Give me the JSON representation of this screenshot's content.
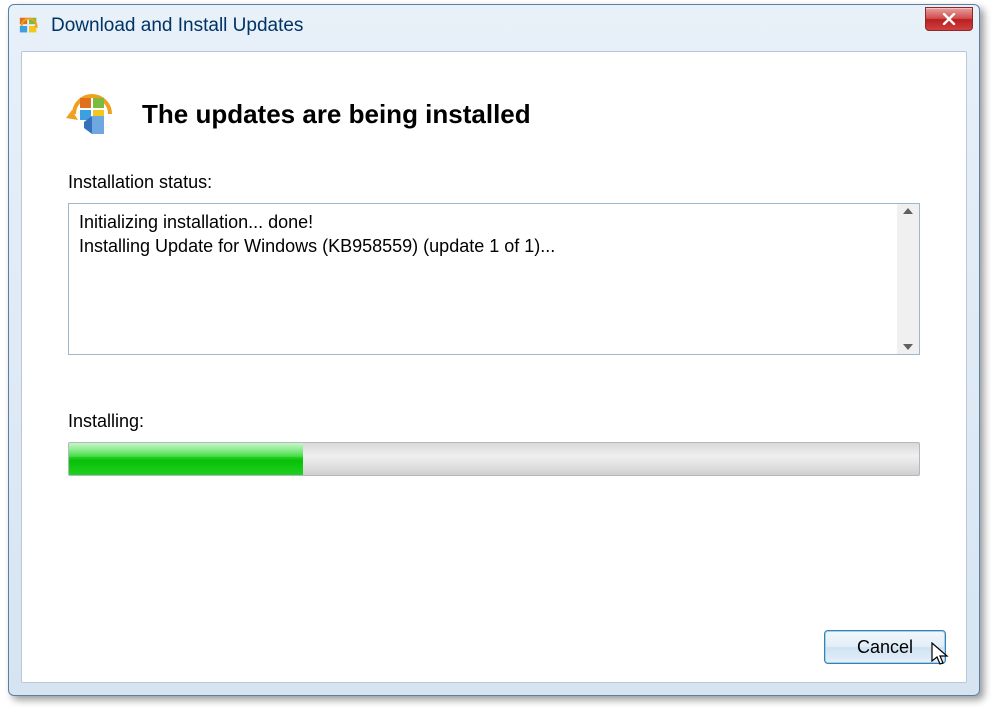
{
  "window": {
    "title": "Download and Install Updates"
  },
  "header": {
    "title": "The updates are being installed"
  },
  "status": {
    "label": "Installation status:",
    "line1": "Initializing installation... done!",
    "line2": "Installing Update for Windows (KB958559) (update 1 of 1)... "
  },
  "progress": {
    "label": "Installing:",
    "percent": 27.5
  },
  "buttons": {
    "cancel": "Cancel"
  }
}
